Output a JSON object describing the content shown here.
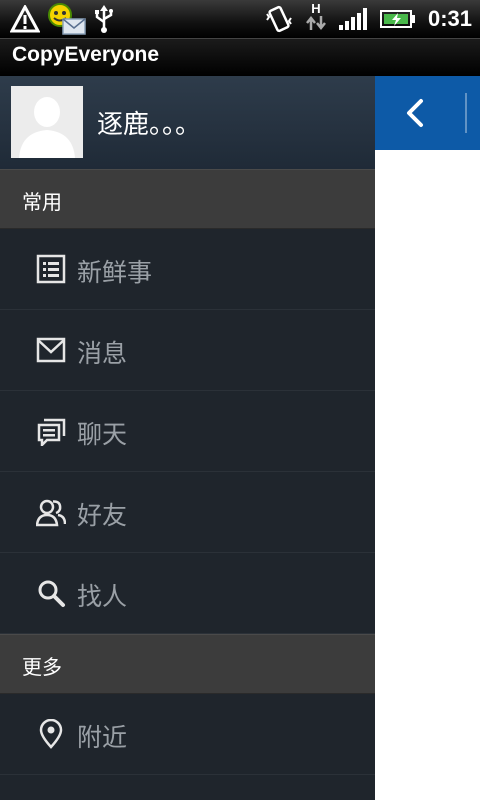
{
  "status_bar": {
    "network_label": "H",
    "time": "0:31"
  },
  "app": {
    "title": "CopyEveryone"
  },
  "profile": {
    "username": "逐鹿。。。"
  },
  "sections": [
    {
      "header": "常用",
      "items": [
        {
          "label": "新鲜事",
          "icon": "news-feed-icon"
        },
        {
          "label": "消息",
          "icon": "mail-icon"
        },
        {
          "label": "聊天",
          "icon": "chat-icon"
        },
        {
          "label": "好友",
          "icon": "friends-icon"
        },
        {
          "label": "找人",
          "icon": "search-icon"
        }
      ]
    },
    {
      "header": "更多",
      "items": [
        {
          "label": "附近",
          "icon": "location-pin-icon"
        }
      ]
    }
  ],
  "colors": {
    "drawer_bg": "#1f252c",
    "section_header_bg": "#3c3c3c",
    "content_header_bg": "#0d5aa7",
    "item_label": "#9aa0a6"
  }
}
